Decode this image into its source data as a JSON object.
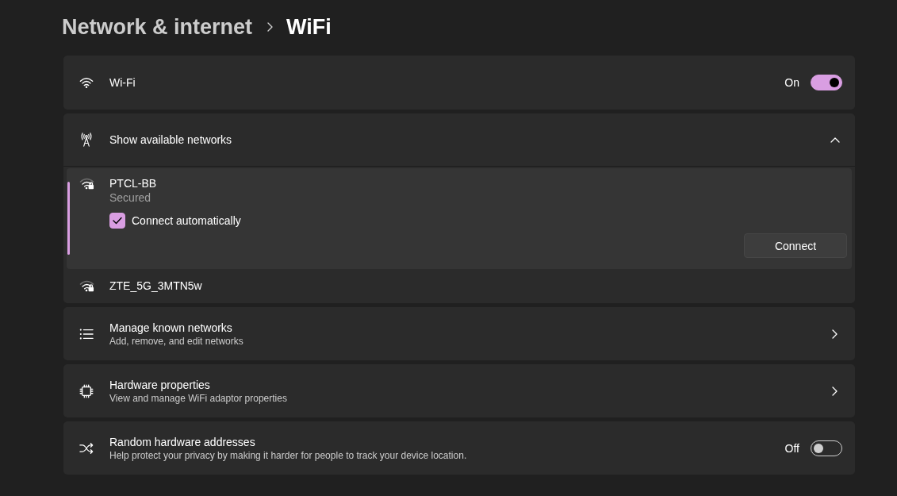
{
  "breadcrumb": [
    {
      "label": "Network & internet",
      "current": false
    },
    {
      "label": "WiFi",
      "current": true
    }
  ],
  "wifi": {
    "label": "Wi-Fi",
    "state_label": "On",
    "on": true
  },
  "available_networks": {
    "label": "Show available networks",
    "expanded": true,
    "networks": [
      {
        "name": "PTCL-BB",
        "selected": true,
        "status": "Secured",
        "connect_automatically": {
          "label": "Connect automatically",
          "checked": true
        },
        "button": "Connect"
      },
      {
        "name": "ZTE_5G_3MTN5w",
        "selected": false
      }
    ]
  },
  "settings": [
    {
      "kind": "link",
      "title": "Manage known networks",
      "description": "Add, remove, and edit networks"
    },
    {
      "kind": "link",
      "title": "Hardware properties",
      "description": "View and manage WiFi adaptor properties"
    },
    {
      "kind": "toggle",
      "title": "Random hardware addresses",
      "description": "Help protect your privacy by making it harder for people to track your device location.",
      "state_label": "Off",
      "on": false
    }
  ]
}
